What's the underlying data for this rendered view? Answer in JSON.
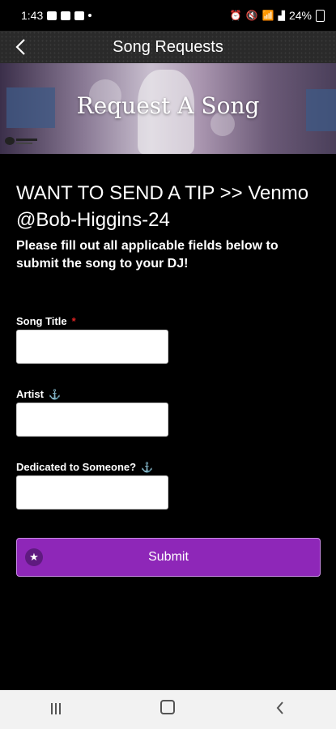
{
  "status_bar": {
    "time": "1:43",
    "battery": "24%"
  },
  "header": {
    "title": "Song Requests",
    "back_icon": "chevron-left-icon"
  },
  "banner": {
    "title": "Request A Song"
  },
  "tip_text": "WANT TO SEND A TIP >> Venmo @Bob-Higgins-24",
  "instructions": "Please fill out all applicable fields below to submit the song to your DJ!",
  "form": {
    "song_title": {
      "label": "Song Title",
      "required_mark": "*",
      "value": ""
    },
    "artist": {
      "label": "Artist",
      "value": ""
    },
    "dedication": {
      "label": "Dedicated to Someone?",
      "value": ""
    },
    "submit_label": "Submit"
  },
  "colors": {
    "accent": "#8e27b8",
    "required": "#e02424",
    "background": "#000000"
  }
}
